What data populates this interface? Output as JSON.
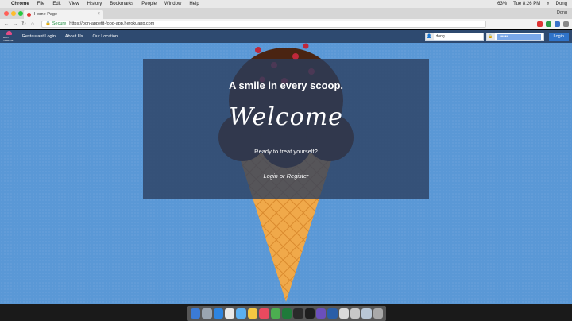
{
  "menubar": {
    "app_name": "Chrome",
    "items": [
      "File",
      "Edit",
      "View",
      "History",
      "Bookmarks",
      "People",
      "Window",
      "Help"
    ],
    "battery": "63%",
    "clock": "Tue 8:26 PM",
    "user": "Dong"
  },
  "browser": {
    "tab_title": "Home Page",
    "tab_close": "×",
    "profile_name": "Dong",
    "secure_label": "Secure",
    "url": "https://bon-appetit-food-app.herokuapp.com",
    "back_icon": "arrow-left-icon",
    "forward_icon": "arrow-right-icon",
    "reload_icon": "reload-icon"
  },
  "site": {
    "logo_text": "BON APPETIT",
    "nav": {
      "restaurant_login": "Restaurant Login",
      "about_us": "About Us",
      "our_location": "Our Location"
    },
    "login": {
      "username_value": "dong",
      "password_value": "••••••",
      "button_label": "Login"
    }
  },
  "hero": {
    "tagline": "A smile in every scoop.",
    "title": "Welcome",
    "subtitle": "Ready to treat yourself?",
    "cta": "Login or Register"
  },
  "colors": {
    "page_bg": "#5a98d6",
    "nav_bg": "#2e4a70",
    "scoop": "#4a2412",
    "cone": "#f0a94a",
    "sprinkles": "#c0283a"
  }
}
